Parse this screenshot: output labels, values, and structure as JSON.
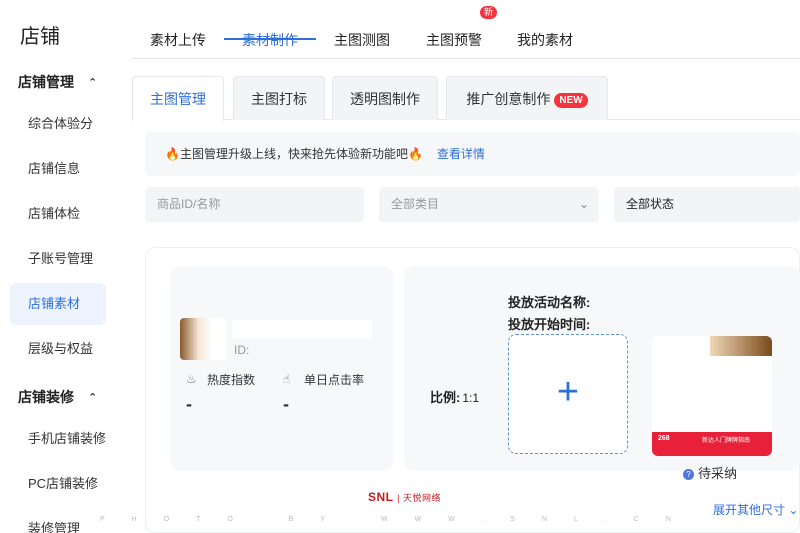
{
  "sidebar": {
    "title": "店铺",
    "section1": {
      "label": "店铺管理",
      "caret": "⌃"
    },
    "items1": [
      "综合体验分",
      "店铺信息",
      "店铺体检",
      "子账号管理",
      "店铺素材",
      "层级与权益"
    ],
    "section2": {
      "label": "店铺装修",
      "caret": "⌃"
    },
    "items2": [
      "手机店铺装修",
      "PC店铺装修",
      "装修管理"
    ],
    "active_item": "店铺素材"
  },
  "topnav": {
    "tabs": [
      "素材上传",
      "素材制作",
      "主图测图",
      "主图预警",
      "我的素材"
    ],
    "active": "素材制作",
    "badge": "新"
  },
  "subtabs": {
    "tabs": [
      "主图管理",
      "主图打标",
      "透明图制作",
      "推广创意制作"
    ],
    "active": "主图管理",
    "new_label": "NEW"
  },
  "notice": {
    "text": "主图管理升级上线，快来抢先体验新功能吧",
    "link": "查看详情"
  },
  "filters": {
    "search_placeholder": "商品ID/名称",
    "category": "全部类目",
    "status": "全部状态"
  },
  "product": {
    "id_label": "ID:",
    "heat_label": "热度指数",
    "heat_value": "-",
    "click_label": "单日点击率",
    "click_value": "-"
  },
  "activity": {
    "name_label": "投放活动名称:",
    "start_label": "投放开始时间:",
    "ratio_label": "比例:",
    "ratio_value": "1:1",
    "upload_symbol": "+",
    "preview_band_left": "268",
    "preview_band_right": "新达人门牌牌指南",
    "status": "待采纳",
    "expand": "展开其他尺寸"
  },
  "watermark": {
    "logo": "SNL",
    "logo_sub": "| 天悦网络",
    "text": "PHOTO BY WWW.SNL.CN"
  },
  "colors": {
    "accent": "#2f6fd8",
    "active_bg": "#eef4ff",
    "badge_red": "#f5333f"
  }
}
